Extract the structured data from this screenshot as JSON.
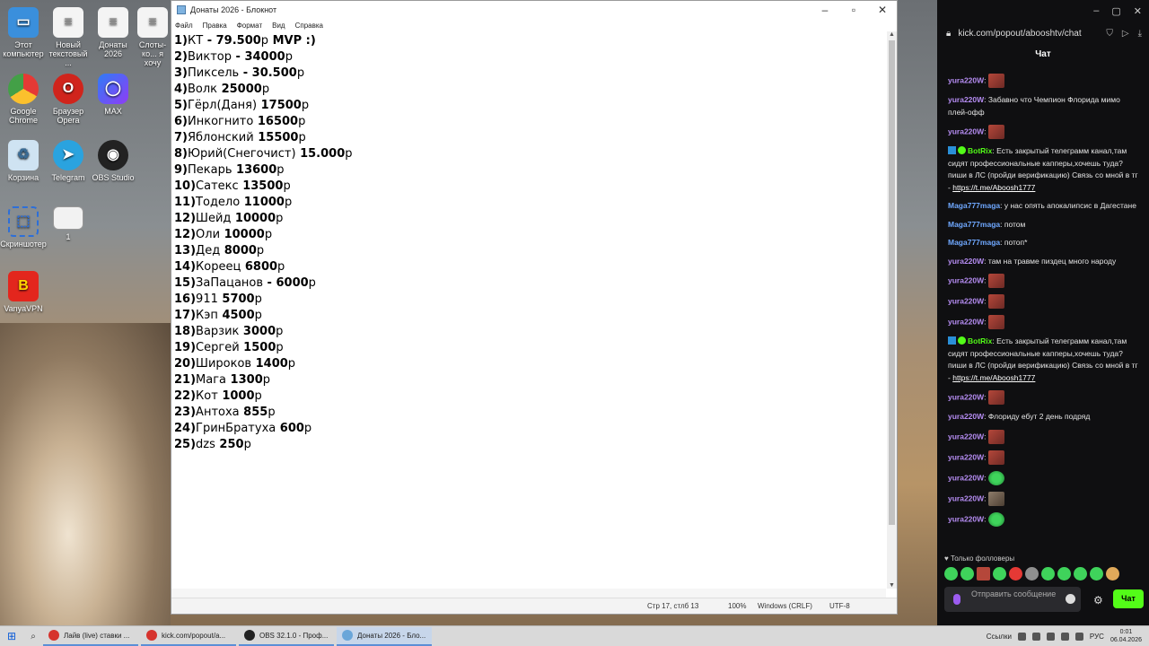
{
  "desktop": {
    "icons": [
      {
        "label": "Этот компьютер"
      },
      {
        "label": "Новый текстовый ..."
      },
      {
        "label": "Донаты 2026"
      },
      {
        "label": "Слоты-ко... я хочу"
      },
      {
        "label": "Google Chrome"
      },
      {
        "label": "Браузер Opera"
      },
      {
        "label": "MAX"
      },
      {
        "label": "Корзина"
      },
      {
        "label": "Telegram"
      },
      {
        "label": "OBS Studio"
      },
      {
        "label": "Скриншотер"
      },
      {
        "label": "1"
      },
      {
        "label": "VanyaVPN"
      }
    ]
  },
  "notepad": {
    "title": "Донаты 2026 - Блокнот",
    "menu": [
      "Файл",
      "Правка",
      "Формат",
      "Вид",
      "Справка"
    ],
    "lines": [
      {
        "num": "1)",
        "name": "КТ",
        "amount": " - 79.500",
        "suffix": "р",
        "extra": " MVP :)"
      },
      {
        "num": "2)",
        "name": "Виктор",
        "amount": " - 34000",
        "suffix": "р",
        "extra": ""
      },
      {
        "num": "3)",
        "name": "Пиксель",
        "amount": " - 30.500",
        "suffix": "р",
        "extra": ""
      },
      {
        "num": "4)",
        "name": "Волк",
        "amount": " 25000",
        "suffix": "р",
        "extra": ""
      },
      {
        "num": "5)",
        "name": "Гёрл(Даня)",
        "amount": " 17500",
        "suffix": "р",
        "extra": ""
      },
      {
        "num": "6)",
        "name": "Инкогнито",
        "amount": " 16500",
        "suffix": "р",
        "extra": ""
      },
      {
        "num": "7)",
        "name": "Яблонский",
        "amount": " 15500",
        "suffix": "р",
        "extra": ""
      },
      {
        "num": "8)",
        "name": "Юрий(Снегочист)",
        "amount": " 15.000",
        "suffix": "р",
        "extra": ""
      },
      {
        "num": "9)",
        "name": "Пекарь",
        "amount": " 13600",
        "suffix": "р",
        "extra": ""
      },
      {
        "num": "10)",
        "name": "Сатекс",
        "amount": " 13500",
        "suffix": "р",
        "extra": ""
      },
      {
        "num": "11)",
        "name": "Тодело",
        "amount": " 11000",
        "suffix": "р",
        "extra": ""
      },
      {
        "num": "12)",
        "name": "Шейд",
        "amount": " 10000",
        "suffix": "р",
        "extra": ""
      },
      {
        "num": "12)",
        "name": "Оли",
        "amount": " 10000",
        "suffix": "р",
        "extra": ""
      },
      {
        "num": "13)",
        "name": "Дед",
        "amount": " 8000",
        "suffix": "р",
        "extra": ""
      },
      {
        "num": "14)",
        "name": "Кореец",
        "amount": " 6800",
        "suffix": "р",
        "extra": ""
      },
      {
        "num": "15)",
        "name": "ЗаПацанов",
        "amount": " - 6000",
        "suffix": "р",
        "extra": ""
      },
      {
        "num": "16)",
        "name": "911",
        "amount": " 5700",
        "suffix": "р",
        "extra": ""
      },
      {
        "num": "17)",
        "name": "Кэп",
        "amount": " 4500",
        "suffix": "р",
        "extra": ""
      },
      {
        "num": "18)",
        "name": "Варзик",
        "amount": " 3000",
        "suffix": "р",
        "extra": ""
      },
      {
        "num": "19)",
        "name": "Сергей",
        "amount": " 1500",
        "suffix": "р",
        "extra": ""
      },
      {
        "num": "20)",
        "name": "Широков",
        "amount": " 1400",
        "suffix": "р",
        "extra": ""
      },
      {
        "num": "21)",
        "name": "Мага",
        "amount": " 1300",
        "suffix": "р",
        "extra": ""
      },
      {
        "num": "22)",
        "name": "Кот",
        "amount": " 1000",
        "suffix": "р",
        "extra": ""
      },
      {
        "num": "23)",
        "name": "Антоха",
        "amount": " 855",
        "suffix": "р",
        "extra": ""
      },
      {
        "num": "24)",
        "name": "ГринБратуха",
        "amount": " 600",
        "suffix": "р",
        "extra": ""
      },
      {
        "num": "25)",
        "name": "dzs",
        "amount": " 250",
        "suffix": "р",
        "extra": ""
      }
    ],
    "status": {
      "position": "Стр 17, стлб 13",
      "zoom": "100%",
      "line_ending": "Windows (CRLF)",
      "encoding": "UTF-8"
    }
  },
  "browser": {
    "url": "kick.com/popout/abooshtv/chat",
    "chat_title": "Чат",
    "messages": [
      {
        "user": "yura220W",
        "text": "",
        "emote": "red"
      },
      {
        "user": "yura220W",
        "text": "Забавно что Чемпион Флорида мимо плей-офф",
        "emote": ""
      },
      {
        "user": "yura220W",
        "text": "",
        "emote": "red"
      },
      {
        "user": "BotRix",
        "text": "Есть закрытый телеграмм канал,там сидят профессиональные капперы,хочешь туда? пиши в ЛС (пройди верификацию) Связь со мной в тг -",
        "link": "https://t.me/Aboosh1777",
        "bot": true
      },
      {
        "user": "Maga777maga",
        "text": "у нас опять апокалипсис в Дагестане",
        "emote": ""
      },
      {
        "user": "Maga777maga",
        "text": "потом",
        "emote": ""
      },
      {
        "user": "Maga777maga",
        "text": "потоп*",
        "emote": ""
      },
      {
        "user": "yura220W",
        "text": "там на травме пиздец много народу",
        "emote": ""
      },
      {
        "user": "yura220W",
        "text": "",
        "emote": "red"
      },
      {
        "user": "yura220W",
        "text": "",
        "emote": "red"
      },
      {
        "user": "yura220W",
        "text": "",
        "emote": "red"
      },
      {
        "user": "BotRix",
        "text": "Есть закрытый телеграмм канал,там сидят профессиональные капперы,хочешь туда? пиши в ЛС (пройди верификацию) Связь со мной в тг -",
        "link": "https://t.me/Aboosh1777",
        "bot": true
      },
      {
        "user": "yura220W",
        "text": "",
        "emote": "red"
      },
      {
        "user": "yura220W",
        "text": "Флориду ебут 2 день подряд",
        "emote": ""
      },
      {
        "user": "yura220W",
        "text": "",
        "emote": "red"
      },
      {
        "user": "yura220W",
        "text": "",
        "emote": "red"
      },
      {
        "user": "yura220W",
        "text": "",
        "emote": "green"
      },
      {
        "user": "yura220W",
        "text": "",
        "emote": "brown"
      },
      {
        "user": "yura220W",
        "text": "",
        "emote": "green"
      }
    ],
    "followers_only": "Только фолловеры",
    "input_placeholder": "Отправить сообщение",
    "send_label": "Чат",
    "colors": {
      "user": "#b58cf2",
      "bot": "#53fc18",
      "maga": "#6fa8ff",
      "accent": "#53fc18"
    }
  },
  "taskbar": {
    "items": [
      {
        "label": "Лайв (live) ставки ...",
        "color": "#d6332d"
      },
      {
        "label": "kick.com/popout/a...",
        "color": "#d6332d"
      },
      {
        "label": "OBS 32.1.0 - Проф...",
        "color": "#222222"
      },
      {
        "label": "Донаты 2026 - Бло...",
        "color": "#6aa6d9"
      }
    ],
    "tray_label": "Ссылки",
    "lang": "РУС",
    "time": "0:01",
    "date": "06.04.2026"
  }
}
